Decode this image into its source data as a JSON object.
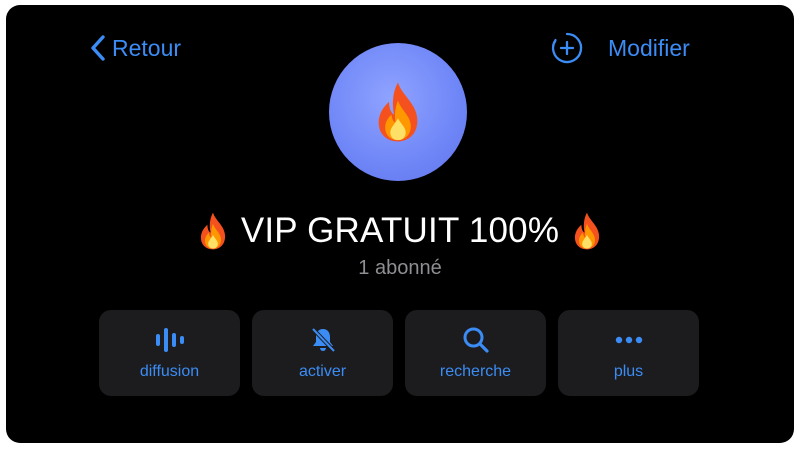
{
  "nav": {
    "back_label": "Retour",
    "edit_label": "Modifier"
  },
  "channel": {
    "avatar_icon": "fire-icon",
    "title": "VIP GRATUIT 100%",
    "title_emoji": "🔥",
    "subscribers": "1 abonné"
  },
  "actions": [
    {
      "label": "diffusion",
      "icon": "broadcast-waveform-icon"
    },
    {
      "label": "activer",
      "icon": "bell-muted-icon"
    },
    {
      "label": "recherche",
      "icon": "search-icon"
    },
    {
      "label": "plus",
      "icon": "more-dots-icon"
    }
  ],
  "colors": {
    "accent": "#3b8cf4",
    "background": "#000000",
    "button_bg": "#1c1c1e",
    "avatar": "#7088f5",
    "secondary_text": "#8e8e93"
  }
}
